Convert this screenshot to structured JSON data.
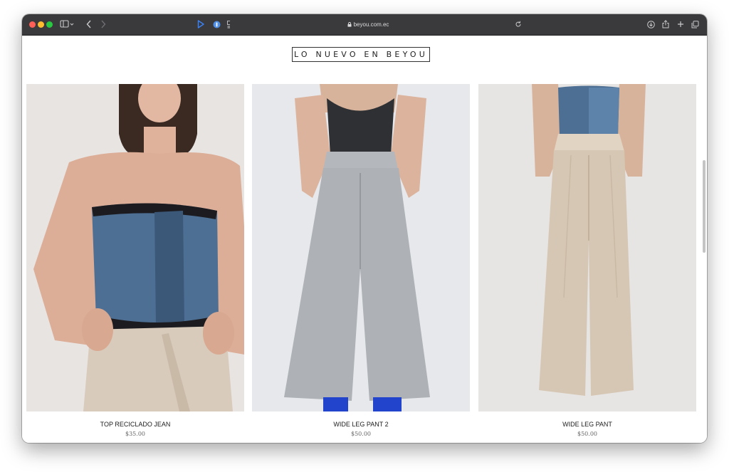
{
  "browser": {
    "url": "beyou.com.ec"
  },
  "page": {
    "heading": "LO NUEVO EN BEYOU"
  },
  "products": [
    {
      "name": "TOP RECICLADO JEAN",
      "price": "$35.00"
    },
    {
      "name": "WIDE LEG PANT 2",
      "price": "$50.00"
    },
    {
      "name": "WIDE LEG PANT",
      "price": "$50.00"
    }
  ],
  "colors": {
    "toolbar": "#3a3a3c",
    "accent_blue": "#3b82f6",
    "denim": "#4a6d91",
    "beige": "#d9cbbb",
    "gray_pant": "#aeb1b5"
  }
}
